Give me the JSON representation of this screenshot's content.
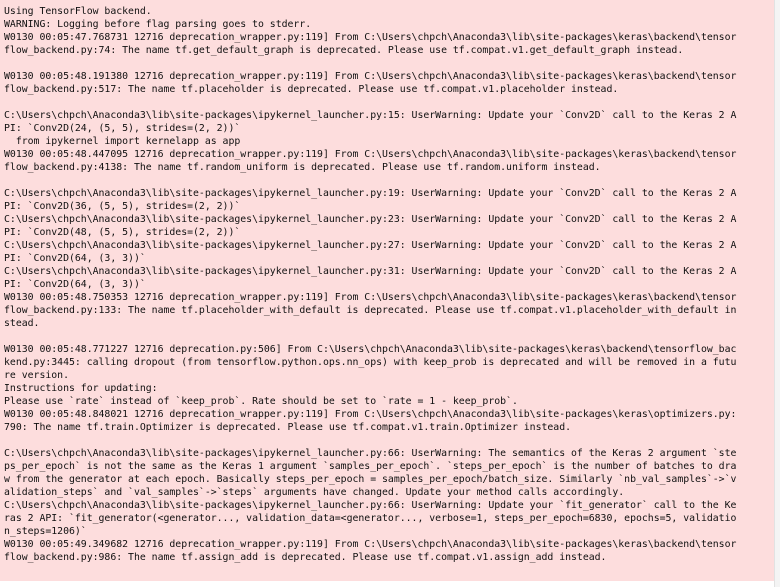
{
  "output": {
    "lines": [
      "Using TensorFlow backend.",
      "WARNING: Logging before flag parsing goes to stderr.",
      "W0130 00:05:47.768731 12716 deprecation_wrapper.py:119] From C:\\Users\\chpch\\Anaconda3\\lib\\site-packages\\keras\\backend\\tensor",
      "flow_backend.py:74: The name tf.get_default_graph is deprecated. Please use tf.compat.v1.get_default_graph instead.",
      "",
      "W0130 00:05:48.191380 12716 deprecation_wrapper.py:119] From C:\\Users\\chpch\\Anaconda3\\lib\\site-packages\\keras\\backend\\tensor",
      "flow_backend.py:517: The name tf.placeholder is deprecated. Please use tf.compat.v1.placeholder instead.",
      "",
      "C:\\Users\\chpch\\Anaconda3\\lib\\site-packages\\ipykernel_launcher.py:15: UserWarning: Update your `Conv2D` call to the Keras 2 A",
      "PI: `Conv2D(24, (5, 5), strides=(2, 2))`",
      "  from ipykernel import kernelapp as app",
      "W0130 00:05:48.447095 12716 deprecation_wrapper.py:119] From C:\\Users\\chpch\\Anaconda3\\lib\\site-packages\\keras\\backend\\tensor",
      "flow_backend.py:4138: The name tf.random_uniform is deprecated. Please use tf.random.uniform instead.",
      "",
      "C:\\Users\\chpch\\Anaconda3\\lib\\site-packages\\ipykernel_launcher.py:19: UserWarning: Update your `Conv2D` call to the Keras 2 A",
      "PI: `Conv2D(36, (5, 5), strides=(2, 2))`",
      "C:\\Users\\chpch\\Anaconda3\\lib\\site-packages\\ipykernel_launcher.py:23: UserWarning: Update your `Conv2D` call to the Keras 2 A",
      "PI: `Conv2D(48, (5, 5), strides=(2, 2))`",
      "C:\\Users\\chpch\\Anaconda3\\lib\\site-packages\\ipykernel_launcher.py:27: UserWarning: Update your `Conv2D` call to the Keras 2 A",
      "PI: `Conv2D(64, (3, 3))`",
      "C:\\Users\\chpch\\Anaconda3\\lib\\site-packages\\ipykernel_launcher.py:31: UserWarning: Update your `Conv2D` call to the Keras 2 A",
      "PI: `Conv2D(64, (3, 3))`",
      "W0130 00:05:48.750353 12716 deprecation_wrapper.py:119] From C:\\Users\\chpch\\Anaconda3\\lib\\site-packages\\keras\\backend\\tensor",
      "flow_backend.py:133: The name tf.placeholder_with_default is deprecated. Please use tf.compat.v1.placeholder_with_default in",
      "stead.",
      "",
      "W0130 00:05:48.771227 12716 deprecation.py:506] From C:\\Users\\chpch\\Anaconda3\\lib\\site-packages\\keras\\backend\\tensorflow_bac",
      "kend.py:3445: calling dropout (from tensorflow.python.ops.nn_ops) with keep_prob is deprecated and will be removed in a futu",
      "re version.",
      "Instructions for updating:",
      "Please use `rate` instead of `keep_prob`. Rate should be set to `rate = 1 - keep_prob`.",
      "W0130 00:05:48.848021 12716 deprecation_wrapper.py:119] From C:\\Users\\chpch\\Anaconda3\\lib\\site-packages\\keras\\optimizers.py:",
      "790: The name tf.train.Optimizer is deprecated. Please use tf.compat.v1.train.Optimizer instead.",
      "",
      "C:\\Users\\chpch\\Anaconda3\\lib\\site-packages\\ipykernel_launcher.py:66: UserWarning: The semantics of the Keras 2 argument `ste",
      "ps_per_epoch` is not the same as the Keras 1 argument `samples_per_epoch`. `steps_per_epoch` is the number of batches to dra",
      "w from the generator at each epoch. Basically steps_per_epoch = samples_per_epoch/batch_size. Similarly `nb_val_samples`->`v",
      "alidation_steps` and `val_samples`->`steps` arguments have changed. Update your method calls accordingly.",
      "C:\\Users\\chpch\\Anaconda3\\lib\\site-packages\\ipykernel_launcher.py:66: UserWarning: Update your `fit_generator` call to the Ke",
      "ras 2 API: `fit_generator(<generator..., validation_data=<generator..., verbose=1, steps_per_epoch=6830, epochs=5, validatio",
      "n_steps=1206)`",
      "W0130 00:05:49.349682 12716 deprecation_wrapper.py:119] From C:\\Users\\chpch\\Anaconda3\\lib\\site-packages\\keras\\backend\\tensor",
      "flow_backend.py:986: The name tf.assign_add is deprecated. Please use tf.compat.v1.assign_add instead."
    ]
  },
  "colors": {
    "stderr_background": "#fddddd",
    "text": "#111111",
    "page_background": "#ffffff"
  }
}
